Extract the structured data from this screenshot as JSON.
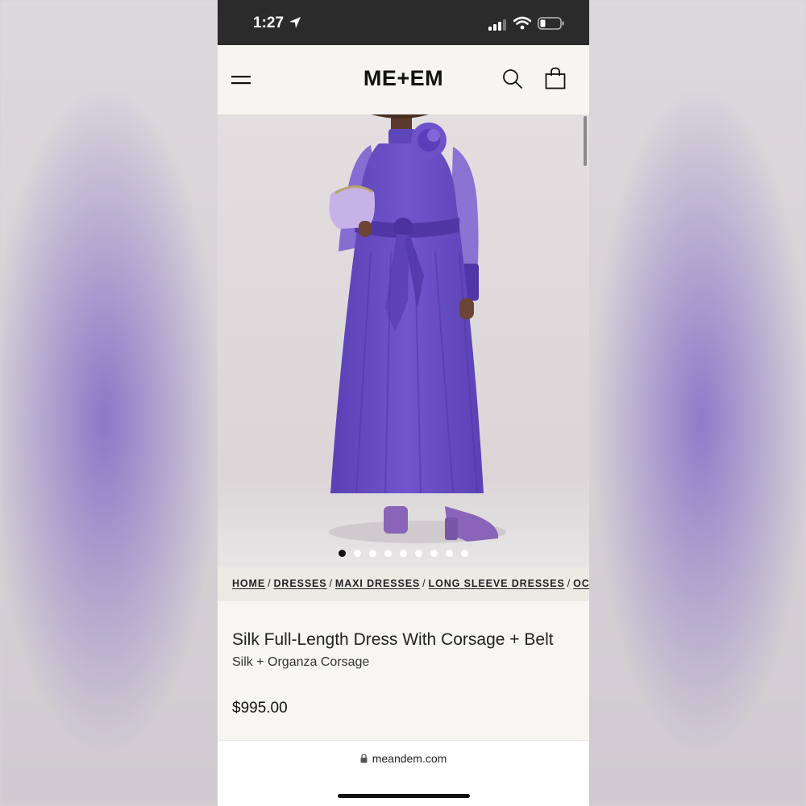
{
  "status_bar": {
    "time": "1:27",
    "icons": [
      "location-arrow-icon",
      "cellular-signal-icon",
      "wifi-icon",
      "battery-icon"
    ]
  },
  "header": {
    "logo": "ME+EM",
    "icons": [
      "menu-icon",
      "search-icon",
      "shopping-bag-icon"
    ]
  },
  "carousel": {
    "total_slides": 9,
    "active_index": 0
  },
  "breadcrumbs": [
    "HOME",
    "DRESSES",
    "MAXI DRESSES",
    "LONG SLEEVE DRESSES",
    "OC"
  ],
  "breadcrumb_separator": "/",
  "product": {
    "title": "Silk Full-Length Dress With Corsage + Belt",
    "subtitle": "Silk + Organza Corsage",
    "price": "$995.00"
  },
  "browser": {
    "url": "meandem.com"
  },
  "colors": {
    "dress": "#6a4fc2",
    "header_bg": "#f7f5f1",
    "breadcrumb_bg": "#ecebe3"
  }
}
